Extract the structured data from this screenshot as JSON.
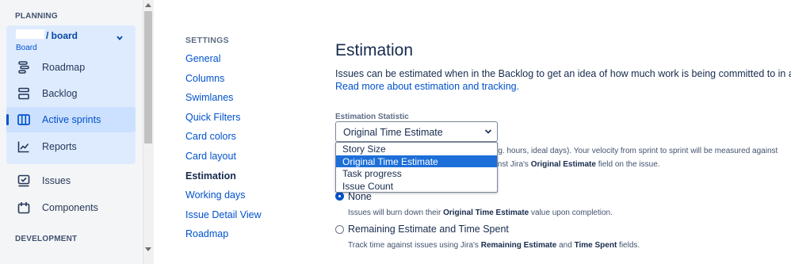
{
  "sidebar": {
    "planning_heading": "PLANNING",
    "board_name": "/ board",
    "board_sub": "Board",
    "items": [
      {
        "label": "Roadmap",
        "icon": "roadmap-icon"
      },
      {
        "label": "Backlog",
        "icon": "backlog-icon"
      },
      {
        "label": "Active sprints",
        "icon": "board-columns-icon"
      },
      {
        "label": "Reports",
        "icon": "reports-chart-icon"
      },
      {
        "label": "Issues",
        "icon": "issues-checkbox-icon"
      },
      {
        "label": "Components",
        "icon": "components-icon"
      }
    ],
    "development_heading": "DEVELOPMENT"
  },
  "settings_nav": {
    "heading": "SETTINGS",
    "links": [
      "General",
      "Columns",
      "Swimlanes",
      "Quick Filters",
      "Card colors",
      "Card layout",
      "Estimation",
      "Working days",
      "Issue Detail View",
      "Roadmap"
    ],
    "current": "Estimation"
  },
  "main": {
    "title": "Estimation",
    "description": "Issues can be estimated when in the Backlog to get an idea of how much work is being committed to in a sprint.",
    "read_more": "Read more about estimation and tracking.",
    "statistic_label": "Estimation Statistic",
    "statistic_value": "Original Time Estimate",
    "options": [
      "Story Size",
      "Original Time Estimate",
      "Task progress",
      "Issue Count"
    ],
    "selected_option_index": 1,
    "behind_line1_prefix": "e.g. hours, ideal days). Your velocity from sprint to sprint will be measured against",
    "behind_line2_prefix": "ainst Jira's ",
    "behind_line2_bold": "Original Estimate",
    "behind_line2_suffix": " field on the issue.",
    "tracking": [
      {
        "label": "None",
        "checked": true,
        "help_prefix": "Issues will burn down their ",
        "help_bold": "Original Time Estimate",
        "help_suffix": " value upon completion."
      },
      {
        "label": "Remaining Estimate and Time Spent",
        "checked": false,
        "help_prefix": "Track time against issues using Jira's ",
        "help_bold": "Remaining Estimate",
        "help_mid": " and ",
        "help_bold2": "Time Spent",
        "help_suffix": " fields."
      }
    ]
  },
  "colors": {
    "accent": "#0052cc",
    "sidebar_bg": "#f4f5f7",
    "selection": "#1c6fd8"
  }
}
